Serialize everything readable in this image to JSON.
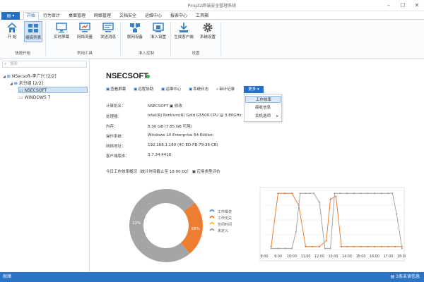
{
  "window": {
    "title": "Ping32终端安全管理系统"
  },
  "menu": {
    "app_button": "▤ ▾",
    "tabs": [
      "开始",
      "行为审计",
      "桌面管理",
      "网络管理",
      "文档安全",
      "运维中心",
      "报表中心",
      "工具箱"
    ],
    "active_tab": "开始"
  },
  "ribbon": {
    "buttons": [
      "开 始",
      "缩搞列表",
      "实时屏幕",
      "网络流量",
      "发送消息",
      "联网设备",
      "准入设置",
      "生成客户端",
      "系统设置"
    ],
    "groups": [
      "快速开始",
      "常用工具",
      "准入控制",
      "设置"
    ]
  },
  "sidebar": {
    "search_placeholder": "搜索",
    "tree": [
      {
        "label": "NSecsoft-李广兴  [2/2]",
        "expander": "◢"
      },
      {
        "label": "未分组  [2/2]",
        "expander": "◢"
      },
      {
        "label": "NSECSOFT",
        "expander": ""
      },
      {
        "label": "WINDOWS 7",
        "expander": ""
      }
    ]
  },
  "detail": {
    "hostname": "NSECSOFT",
    "actions": [
      "查看屏幕",
      "远程协助",
      "运维中心",
      "系统日志",
      "审计记录"
    ],
    "more_button": "更多 ▾",
    "dropdown": [
      {
        "label": "工作效率",
        "highlighted": true,
        "submenu": false
      },
      {
        "label": "接收信息",
        "highlighted": false,
        "submenu": false
      },
      {
        "label": "关机选项",
        "highlighted": false,
        "submenu": true
      }
    ],
    "info": [
      {
        "key": "计算机名：",
        "value": "NSECSOFT   ▣ 修改"
      },
      {
        "key": "处理器：",
        "value": "Intel(R) Pentium(R) Gold G5500 CPU @ 3.80GHz"
      },
      {
        "key": "内存：",
        "value": "8.00 GB (7.85 GB 可用)"
      },
      {
        "key": "操作系统：",
        "value": "Windows 10 Enterprise 64 Edition"
      },
      {
        "key": "网络地址：",
        "value": "192.168.1.180  (4C-ED-FB-79-36-CB)"
      },
      {
        "key": "客户端版本：",
        "value": "3.7.34.4416"
      }
    ],
    "summary": "今日工作效率概况（统计时间截止至 18:00:00）    ▣ 应用类型评价"
  },
  "chart_data": [
    {
      "type": "pie",
      "slices": [
        {
          "name": "工作相关",
          "value": 0,
          "color": "#5aa0dc"
        },
        {
          "name": "工作无关",
          "value": 22,
          "color": "#ed7d31"
        },
        {
          "name": "空闲时间",
          "value": 0,
          "color": "#f5c02a"
        },
        {
          "name": "未定义",
          "value": 68,
          "color": "#a5a5a5"
        }
      ],
      "labels": [
        "68%",
        "22%"
      ]
    },
    {
      "type": "line",
      "x": [
        "8:00",
        "9:00",
        "10:00",
        "11:00",
        "12:00",
        "13:00",
        "14:00",
        "15:00",
        "16:00",
        "17:00",
        "18:00"
      ],
      "series": [
        {
          "color": "#ed7d31",
          "points": [
            [
              8.5,
              5
            ],
            [
              9.0,
              95
            ],
            [
              9.5,
              95
            ],
            [
              10.0,
              95
            ],
            [
              10.5,
              75
            ],
            [
              11.0,
              5
            ],
            [
              11.5,
              5
            ],
            [
              12.0,
              5
            ],
            [
              12.5,
              15
            ],
            [
              12.8,
              85
            ],
            [
              13.2,
              90
            ],
            [
              13.6,
              5
            ],
            [
              14.0,
              5
            ],
            [
              14.5,
              5
            ],
            [
              15.0,
              5
            ],
            [
              15.5,
              5
            ],
            [
              16.0,
              5
            ],
            [
              16.5,
              5
            ],
            [
              17.0,
              5
            ],
            [
              17.5,
              5
            ],
            [
              18.0,
              5
            ]
          ]
        },
        {
          "color": "#a5a5a5",
          "points": [
            [
              8.5,
              2
            ],
            [
              9.0,
              2
            ],
            [
              9.5,
              2
            ],
            [
              10.0,
              2
            ],
            [
              10.3,
              30
            ],
            [
              10.6,
              95
            ],
            [
              11.0,
              95
            ],
            [
              11.3,
              95
            ],
            [
              11.6,
              95
            ],
            [
              12.0,
              80
            ],
            [
              12.4,
              2
            ],
            [
              12.8,
              2
            ],
            [
              13.1,
              95
            ],
            [
              13.5,
              95
            ],
            [
              14.0,
              95
            ],
            [
              14.5,
              95
            ],
            [
              15.0,
              95
            ],
            [
              15.5,
              95
            ],
            [
              16.0,
              95
            ],
            [
              16.5,
              95
            ],
            [
              17.0,
              95
            ],
            [
              17.3,
              95
            ],
            [
              17.6,
              60
            ],
            [
              18.0,
              2
            ]
          ]
        }
      ],
      "ylim": [
        0,
        100
      ],
      "grid": true
    }
  ],
  "statusbar": {
    "left": "就绪",
    "right": "▤ 3条未读信息"
  }
}
